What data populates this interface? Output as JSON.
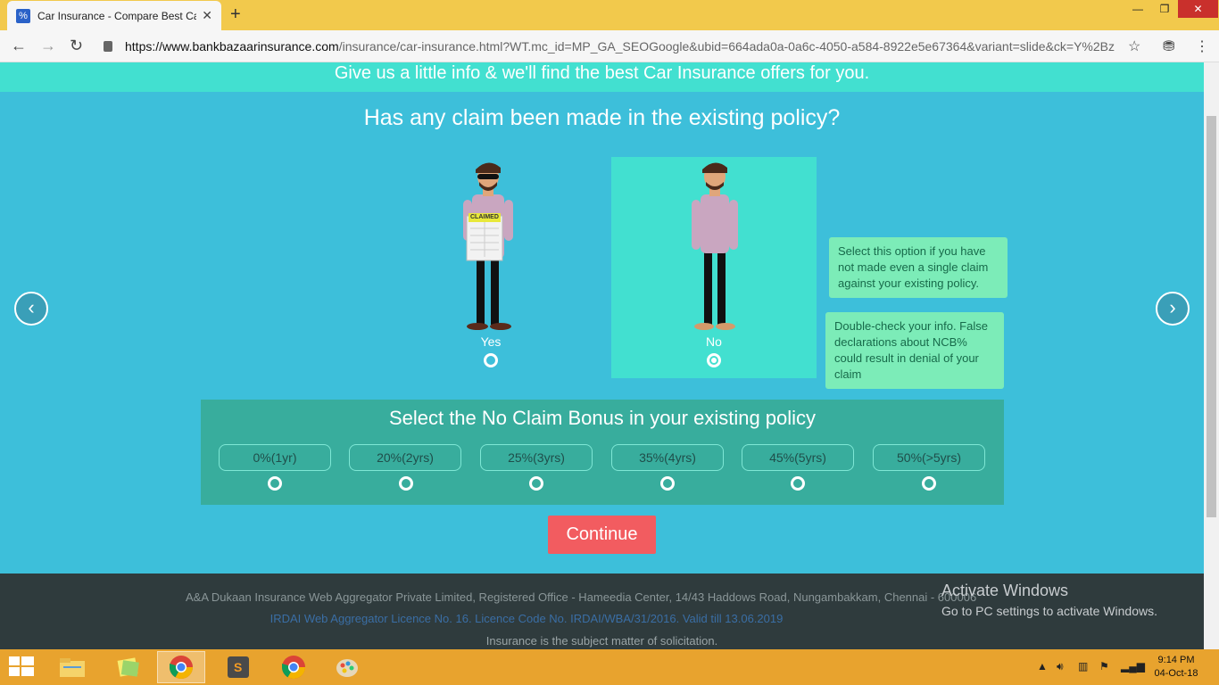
{
  "browser": {
    "tab_title": "Car Insurance - Compare Best Ca",
    "tab_close": "✕",
    "new_tab": "+",
    "url_host": "https://www.bankbazaarinsurance.com",
    "url_path": "/insurance/car-insurance.html?WT.mc_id=MP_GA_SEOGoogle&ubid=664ada0a-0a6c-4050-a584-8922e5e67364&variant=slide&ck=Y%2Bz..."
  },
  "page": {
    "banner": "Give us a little info & we'll find the best Car Insurance offers for you.",
    "question": "Has any claim been made in the existing policy?",
    "options": [
      {
        "label": "Yes",
        "badge": "CLAIMED",
        "selected": false
      },
      {
        "label": "No",
        "selected": true
      }
    ],
    "tooltips": {
      "select_hint": "Select this option if you have not made even a single claim against your existing policy.",
      "warning": "Double-check your info. False declarations about NCB% could result in denial of your claim"
    },
    "ncb": {
      "title": "Select the No Claim Bonus in your existing policy",
      "options": [
        "0%(1yr)",
        "20%(2yrs)",
        "25%(3yrs)",
        "35%(4yrs)",
        "45%(5yrs)",
        "50%(>5yrs)"
      ]
    },
    "continue_label": "Continue"
  },
  "footer": {
    "line1": "A&A Dukaan Insurance Web Aggregator Private Limited, Registered Office - Hameedia Center, 14/43 Haddows Road, Nungambakkam, Chennai - 600006",
    "line2": "IRDAI Web Aggregator Licence No. 16. Licence Code No. IRDAI/WBA/31/2016. Valid till 13.06.2019",
    "line3": "Insurance is the subject matter of solicitation."
  },
  "watermark": {
    "title": "Activate Windows",
    "subtitle": "Go to PC settings to activate Windows."
  },
  "taskbar": {
    "time": "9:14 PM",
    "date": "04-Oct-18"
  }
}
